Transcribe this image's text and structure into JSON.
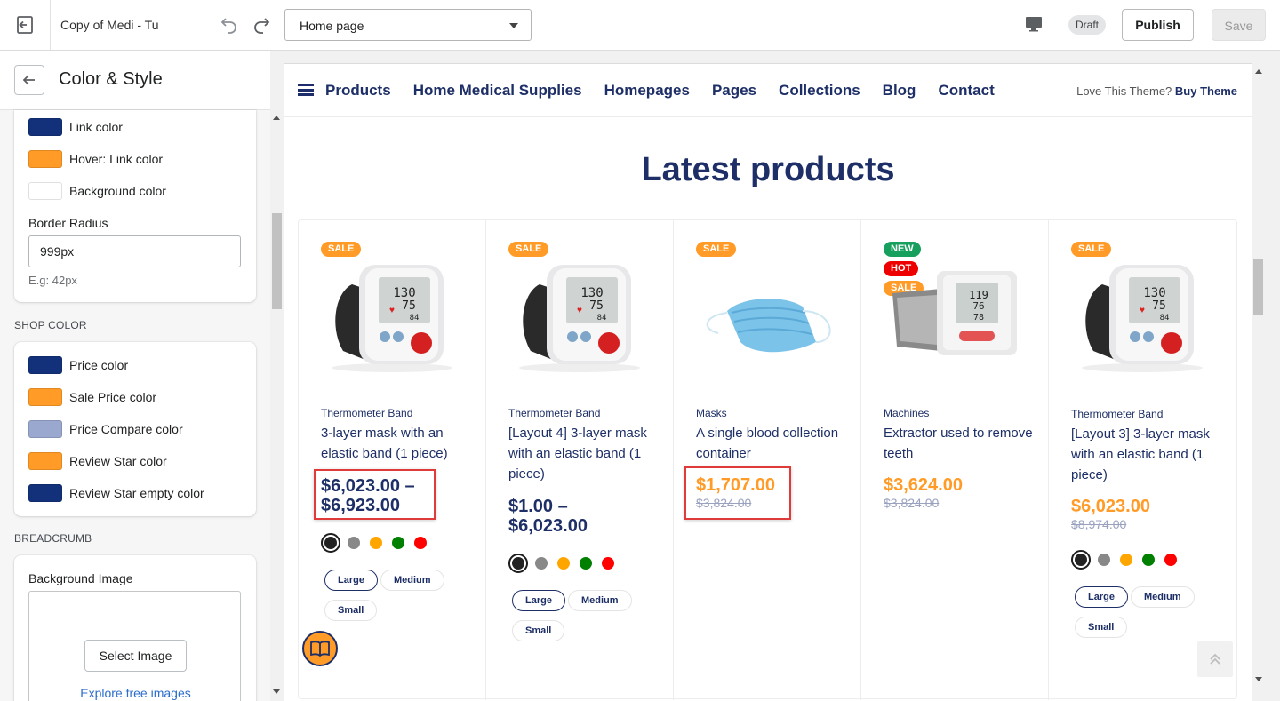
{
  "topbar": {
    "store_title": "Copy of Medi - Tu",
    "page_select": "Home page",
    "draft_badge": "Draft",
    "publish_label": "Publish",
    "save_label": "Save"
  },
  "sidebar": {
    "title": "Color & Style",
    "general": {
      "swatches": [
        {
          "label": "Link color",
          "color": "#13317b"
        },
        {
          "label": "Hover: Link color",
          "color": "#ff9b26"
        },
        {
          "label": "Background color",
          "color": "#ffffff"
        }
      ],
      "border_radius_label": "Border Radius",
      "border_radius_value": "999px",
      "border_radius_help": "E.g: 42px"
    },
    "shop_color": {
      "title": "SHOP COLOR",
      "swatches": [
        {
          "label": "Price color",
          "color": "#13317b"
        },
        {
          "label": "Sale Price color",
          "color": "#ff9b26"
        },
        {
          "label": "Price Compare color",
          "color": "#9aa8cf"
        },
        {
          "label": "Review Star color",
          "color": "#ff9b26"
        },
        {
          "label": "Review Star empty color",
          "color": "#13317b"
        }
      ]
    },
    "breadcrumb": {
      "title": "BREADCRUMB",
      "bg_image_label": "Background Image",
      "select_image": "Select Image",
      "explore": "Explore free images"
    }
  },
  "preview": {
    "nav": {
      "items": [
        "Products",
        "Home Medical Supplies",
        "Homepages",
        "Pages",
        "Collections",
        "Blog",
        "Contact"
      ],
      "promo_text": "Love This Theme?",
      "promo_link": "Buy Theme"
    },
    "section_title": "Latest products",
    "products": [
      {
        "badges": [
          "SALE"
        ],
        "category": "Thermometer Band",
        "name": "3-layer mask with an elastic band (1 piece)",
        "price_line1": "$6,023.00 –",
        "price_line2": "$6,923.00",
        "compare": "",
        "sizes": [
          "Large",
          "Medium",
          "Small"
        ]
      },
      {
        "badges": [
          "SALE"
        ],
        "category": "Thermometer Band",
        "name": "[Layout 4] 3-layer mask with an elastic band (1 piece)",
        "price_line1": "$1.00 –",
        "price_line2": "$6,023.00",
        "compare": "",
        "sizes": [
          "Large",
          "Medium",
          "Small"
        ]
      },
      {
        "badges": [
          "SALE"
        ],
        "category": "Masks",
        "name": "A single blood collection container",
        "price_line1": "$1,707.00",
        "price_line2": "",
        "compare": "$3,824.00",
        "sizes": []
      },
      {
        "badges": [
          "NEW",
          "HOT",
          "SALE"
        ],
        "category": "Machines",
        "name": "Extractor used to remove teeth",
        "price_line1": "$3,624.00",
        "price_line2": "",
        "compare": "$3,824.00",
        "sizes": []
      },
      {
        "badges": [
          "SALE"
        ],
        "category": "Thermometer Band",
        "name": "[Layout 3] 3-layer mask with an elastic band (1 piece)",
        "price_line1": "$6,023.00",
        "price_line2": "",
        "compare": "$8,974.00",
        "sizes": [
          "Large",
          "Medium",
          "Small"
        ]
      }
    ],
    "swatch_colors": [
      "#222222",
      "#888888",
      "#ffa500",
      "#008000",
      "#ff0000"
    ],
    "badge_colors": {
      "SALE": "#ff9b26",
      "NEW": "#17a05d",
      "HOT": "#ee0000"
    }
  }
}
